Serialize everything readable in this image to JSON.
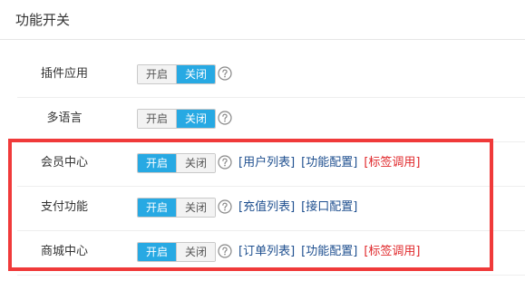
{
  "header": {
    "title": "功能开关"
  },
  "toggle_labels": {
    "on": "开启",
    "off": "关闭"
  },
  "help_icon": "question-circle-icon",
  "colors": {
    "accent": "#27a9e3",
    "link": "#1e4f8f",
    "link_alert": "#e0282b",
    "highlight_border": "#f03a3a"
  },
  "rows": [
    {
      "label": "插件应用",
      "state": "off",
      "links": []
    },
    {
      "label": "多语言",
      "state": "off",
      "links": []
    },
    {
      "label": "会员中心",
      "state": "on",
      "links": [
        {
          "text": "[用户列表]",
          "style": "normal"
        },
        {
          "text": "[功能配置]",
          "style": "normal"
        },
        {
          "text": "[标签调用]",
          "style": "red"
        }
      ]
    },
    {
      "label": "支付功能",
      "state": "on",
      "links": [
        {
          "text": "[充值列表]",
          "style": "normal"
        },
        {
          "text": "[接口配置]",
          "style": "normal"
        }
      ]
    },
    {
      "label": "商城中心",
      "state": "on",
      "links": [
        {
          "text": "[订单列表]",
          "style": "normal"
        },
        {
          "text": "[功能配置]",
          "style": "normal"
        },
        {
          "text": "[标签调用]",
          "style": "red"
        }
      ]
    }
  ]
}
